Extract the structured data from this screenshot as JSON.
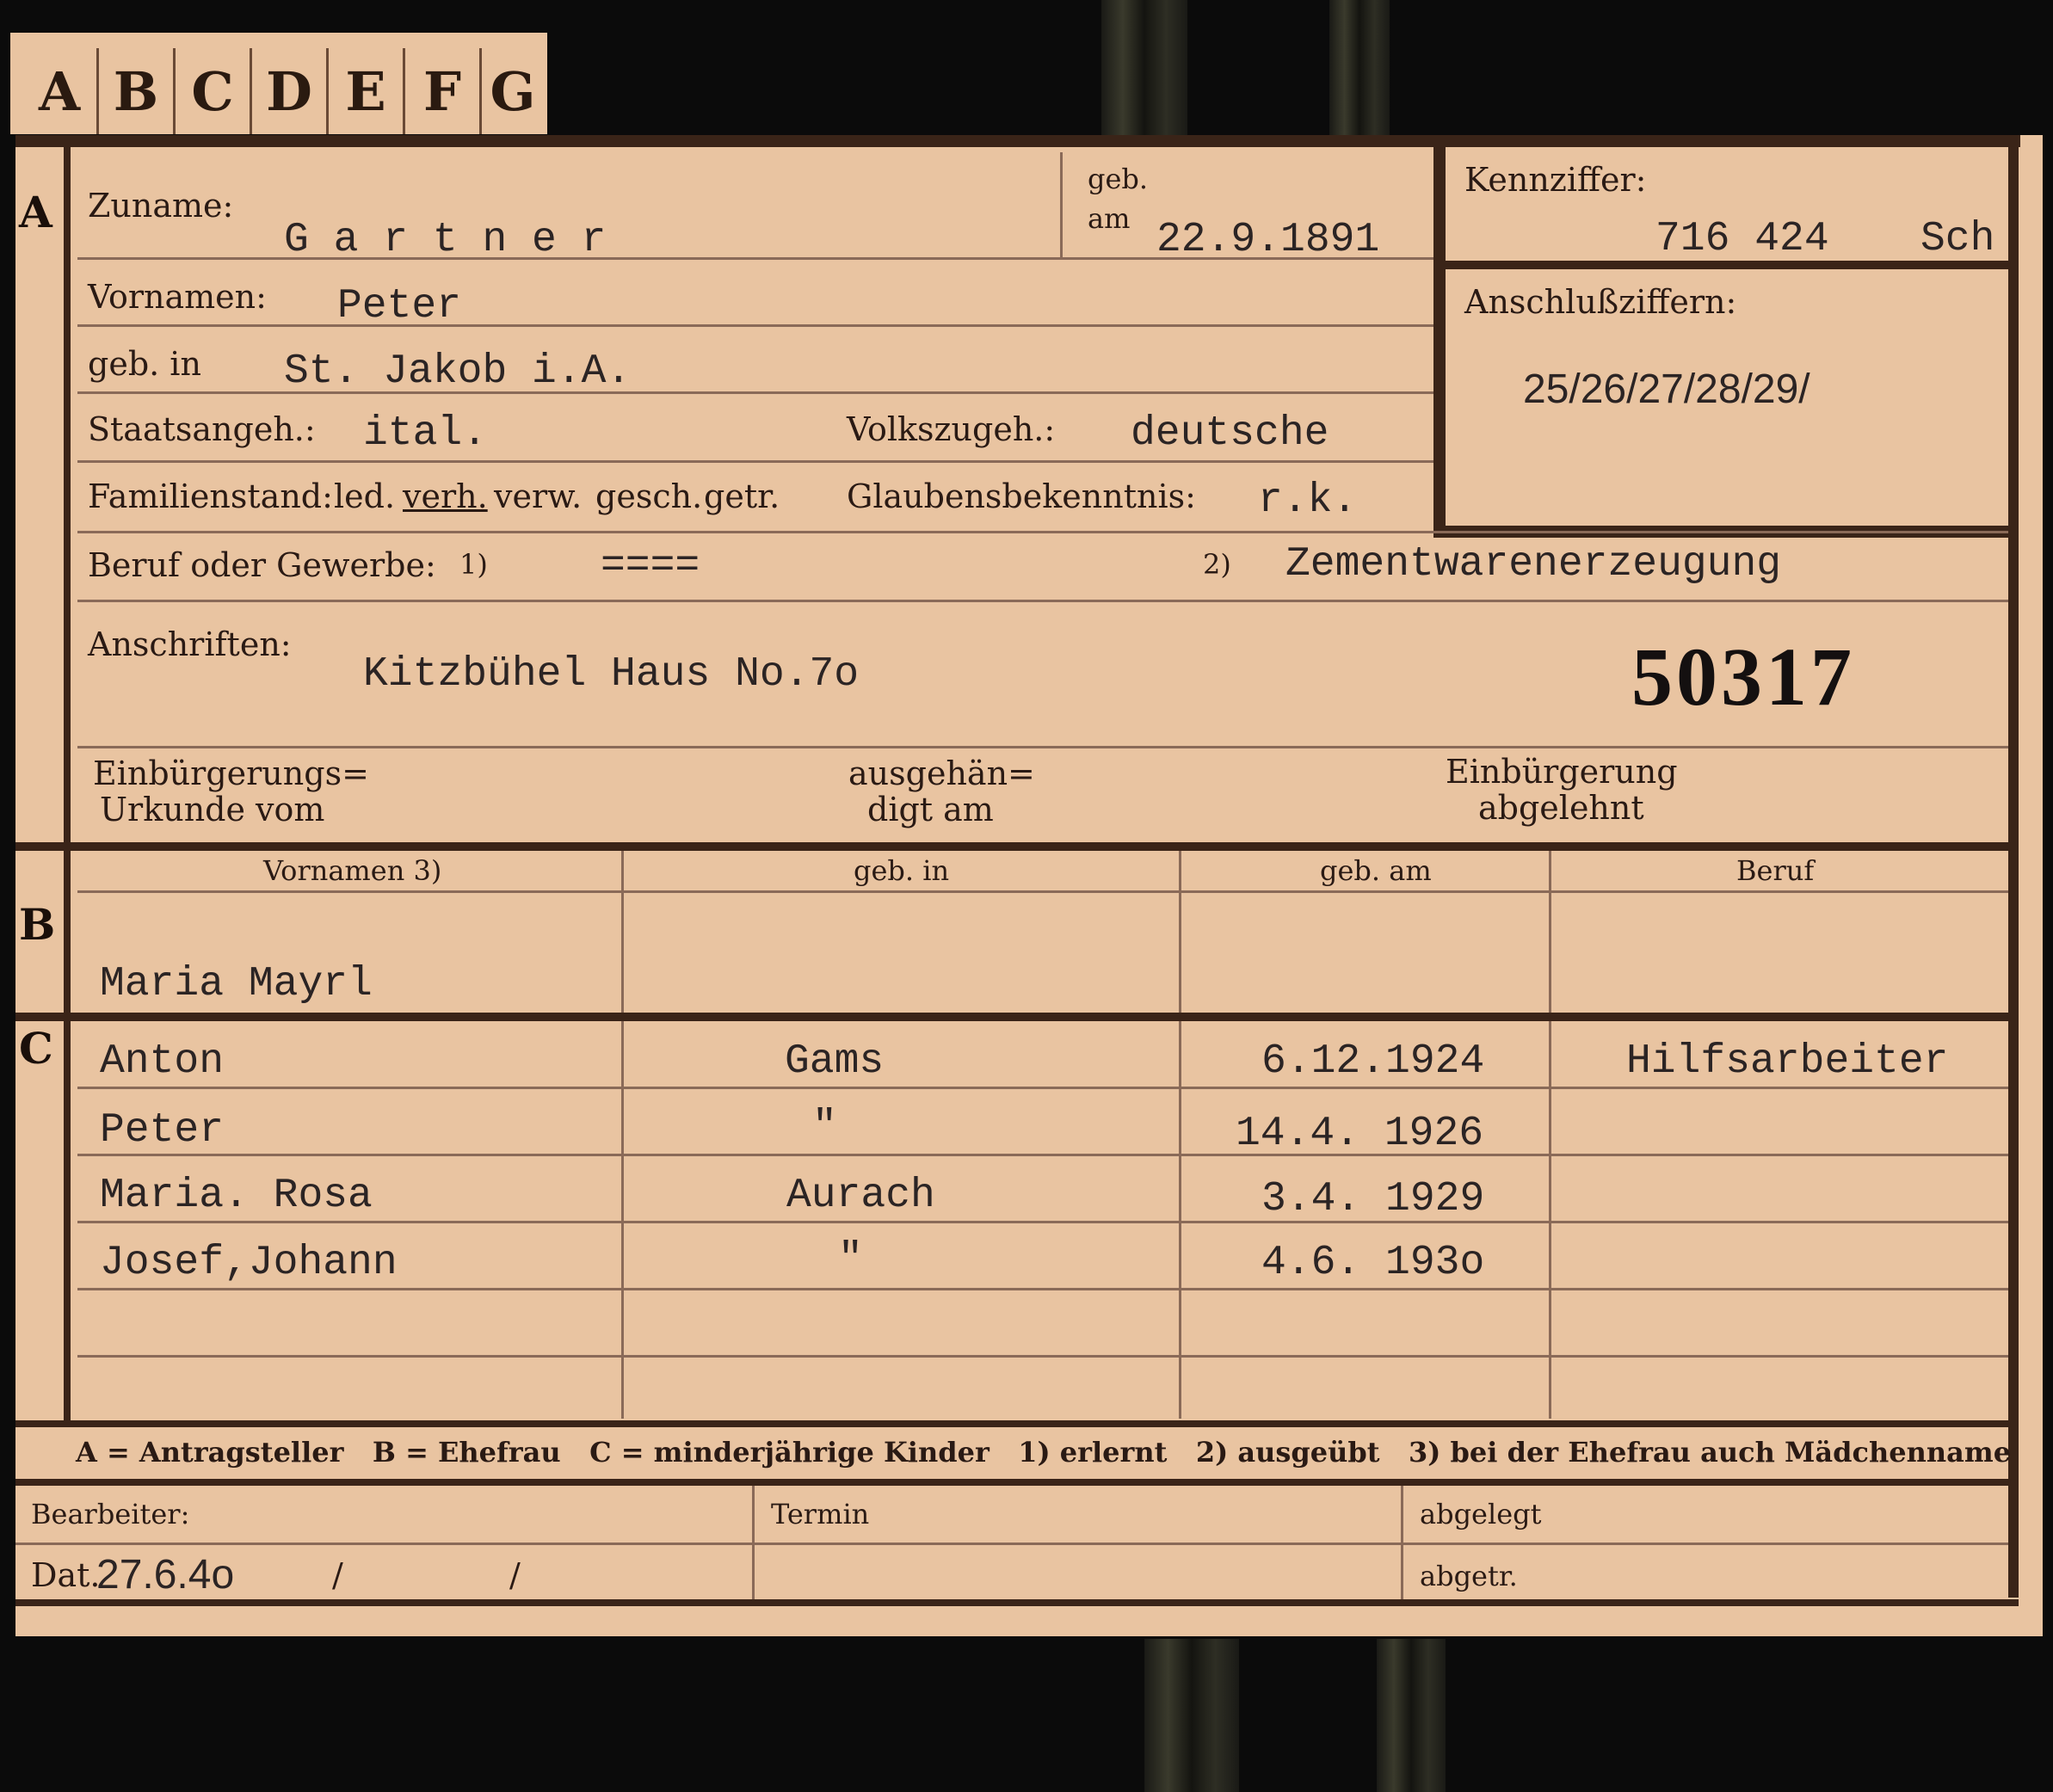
{
  "tabs": [
    "A",
    "B",
    "C",
    "D",
    "E",
    "F",
    "G"
  ],
  "section_a": {
    "marker": "A",
    "zuname_label": "Zuname:",
    "zuname_value": "G a r t n e r",
    "geb_label_1": "geb.",
    "geb_label_2": "am",
    "geb_am_value": "22.9.1891",
    "kennziffer_label": "Kennziffer:",
    "kennziffer_value": "716 424",
    "kennziffer_suffix": "Sch",
    "anschluss_label": "Anschlußziffern:",
    "anschluss_value": "25/26/27/28/29/",
    "vornamen_label": "Vornamen:",
    "vornamen_value": "Peter",
    "geb_in_label": "geb. in",
    "geb_in_value": "St. Jakob i.A.",
    "staatsangeh_label": "Staatsangeh.:",
    "staatsangeh_value": "ital.",
    "volkszugeh_label": "Volkszugeh.:",
    "volkszugeh_value": "deutsche",
    "familienstand_label": "Familienstand:",
    "familienstand_options": [
      "led.",
      "verh.",
      "verw.",
      "gesch.",
      "getr."
    ],
    "familienstand_selected": "verh.",
    "glaubens_label": "Glaubensbekenntnis:",
    "glaubens_value": "r.k.",
    "beruf_label": "Beruf oder Gewerbe:",
    "beruf_note1": "1)",
    "beruf_value1": "====",
    "beruf_note2": "2)",
    "beruf_value2": "Zementwarenerzeugung",
    "anschriften_label": "Anschriften:",
    "anschriften_value": "Kitzbühel Haus No.7o",
    "stamp_number": "50317",
    "einbuergerung_urkunde_l1": "Einbürgerungs=",
    "einbuergerung_urkunde_l2": "Urkunde vom",
    "ausgehaendigt_l1": "ausgehän=",
    "ausgehaendigt_l2": "digt am",
    "abgelehnt_l1": "Einbürgerung",
    "abgelehnt_l2": "abgelehnt"
  },
  "section_b": {
    "marker": "B",
    "headers": [
      "Vornamen 3)",
      "geb. in",
      "geb. am",
      "Beruf"
    ],
    "row": {
      "vornamen": "Maria Mayrl",
      "geb_in": "",
      "geb_am": "",
      "beruf": ""
    }
  },
  "section_c": {
    "marker": "C",
    "rows": [
      {
        "vornamen": "Anton",
        "geb_in": "Gams",
        "geb_am": "6.12.1924",
        "beruf": "Hilfsarbeiter"
      },
      {
        "vornamen": "Peter",
        "geb_in": "\"",
        "geb_am": "14.4. 1926",
        "beruf": ""
      },
      {
        "vornamen": "Maria. Rosa",
        "geb_in": "Aurach",
        "geb_am": "3.4. 1929",
        "beruf": ""
      },
      {
        "vornamen": "Josef,Johann",
        "geb_in": "\"",
        "geb_am": "4.6. 193o",
        "beruf": ""
      },
      {
        "vornamen": "",
        "geb_in": "",
        "geb_am": "",
        "beruf": ""
      },
      {
        "vornamen": "",
        "geb_in": "",
        "geb_am": "",
        "beruf": ""
      }
    ]
  },
  "legend": "A = Antragsteller   B = Ehefrau   C = minderjährige Kinder   1) erlernt   2) ausgeübt   3) bei der Ehefrau auch Mädchenname",
  "footer": {
    "bearbeiter_label": "Bearbeiter:",
    "dat_label": "Dat.",
    "dat_value": "27.6.4o",
    "slash1": "/",
    "slash2": "/",
    "termin_label": "Termin",
    "abgelegt_label": "abgelegt",
    "abgetr_label": "abgetr."
  },
  "colors": {
    "card": "#e9c4a1",
    "ink": "#2b2424",
    "rule": "#3a2418"
  }
}
